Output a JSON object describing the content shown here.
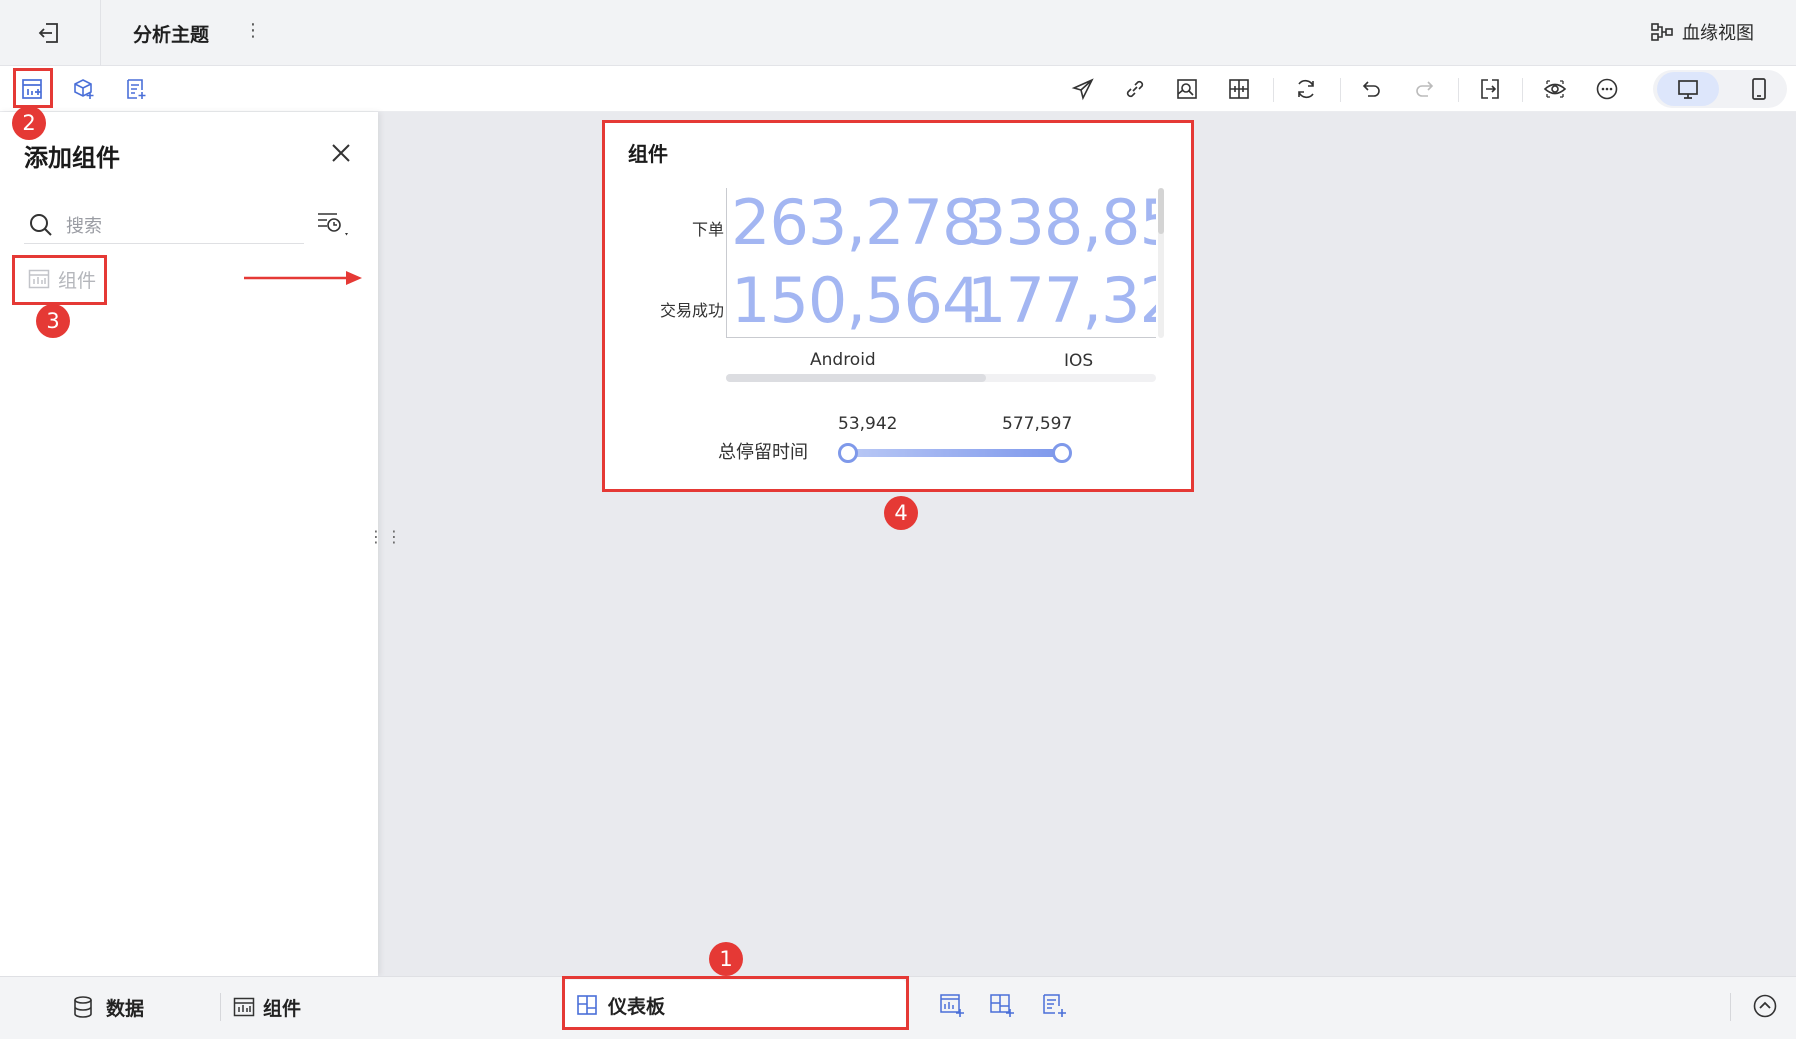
{
  "titlebar": {
    "title": "分析主题",
    "more": "⋮",
    "lineage_label": "血缘视图"
  },
  "panel": {
    "title": "添加组件",
    "search_placeholder": "搜索",
    "items": [
      {
        "label": "组件"
      }
    ]
  },
  "widget": {
    "title": "组件",
    "rows": [
      {
        "label": "下单",
        "values": [
          "263,278",
          "338,85"
        ]
      },
      {
        "label": "交易成功",
        "values": [
          "150,564",
          "177,32"
        ]
      }
    ],
    "columns": [
      "Android",
      "IOS"
    ],
    "range": {
      "label": "总停留时间",
      "min": "53,942",
      "max": "577,597"
    }
  },
  "bottombar": {
    "data_tab": "数据",
    "component_tab": "组件",
    "dashboard_tab": "仪表板"
  },
  "annotations": [
    "1",
    "2",
    "3",
    "4"
  ],
  "colors": {
    "accent": "#4a6fd8",
    "highlight_red": "#e53935",
    "value_blue": "#a3b6f2"
  }
}
